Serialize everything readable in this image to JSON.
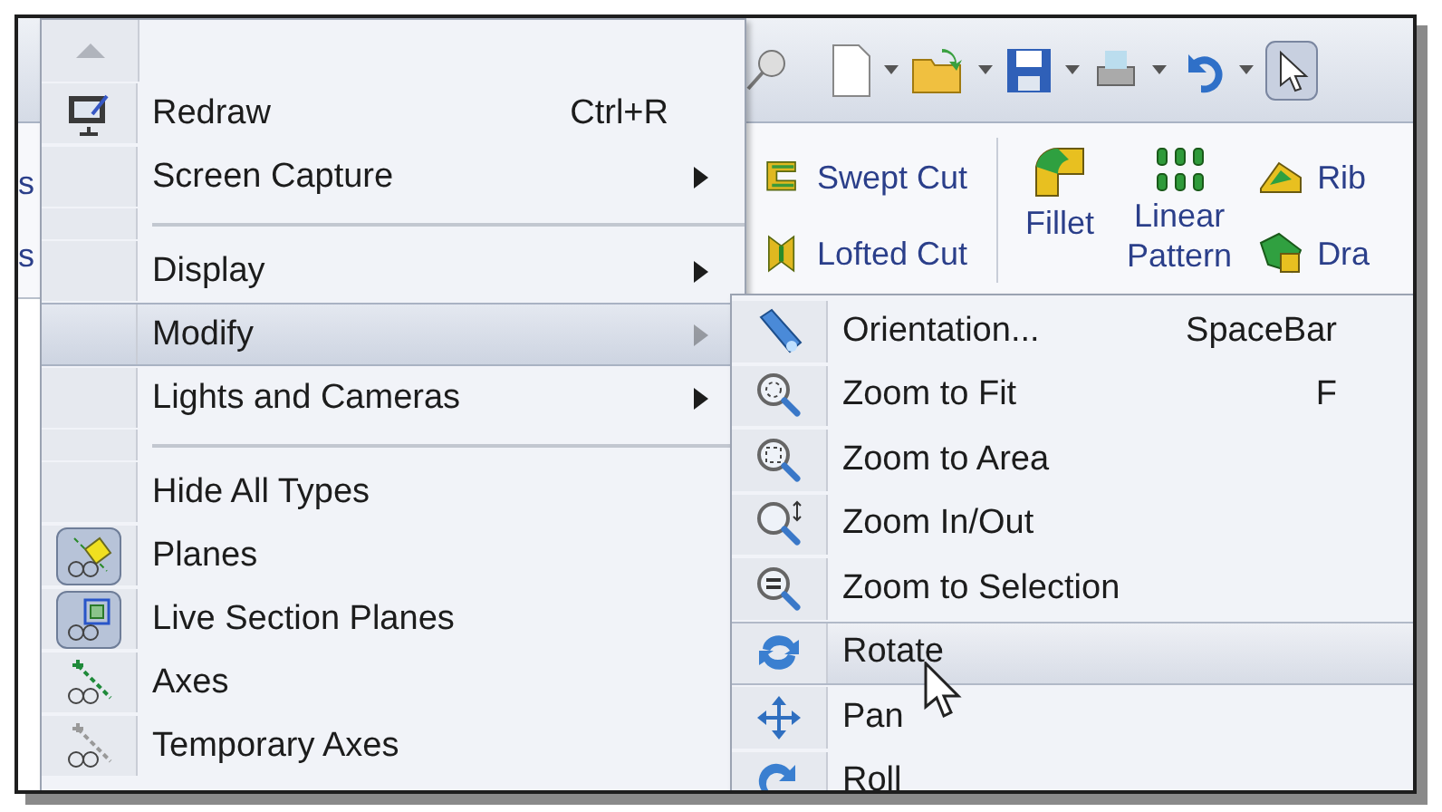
{
  "left_edge_fragments": [
    "s",
    "s"
  ],
  "ribbon": {
    "items": [
      {
        "label": "Swept Cut"
      },
      {
        "label": "Lofted Cut"
      },
      {
        "label": "Fillet"
      },
      {
        "label": "Linear Pattern"
      },
      {
        "label": "Rib"
      },
      {
        "label": "Dra"
      }
    ]
  },
  "main_menu": {
    "items": [
      {
        "kind": "item",
        "label": "Redraw",
        "shortcut": "Ctrl+R",
        "submenu": false,
        "selected": false,
        "checked": false
      },
      {
        "kind": "item",
        "label": "Screen Capture",
        "submenu": true,
        "selected": false,
        "checked": false
      },
      {
        "kind": "separator"
      },
      {
        "kind": "item",
        "label": "Display",
        "submenu": true,
        "selected": false,
        "checked": false
      },
      {
        "kind": "item",
        "label": "Modify",
        "submenu": true,
        "selected": true,
        "checked": false
      },
      {
        "kind": "item",
        "label": "Lights and Cameras",
        "submenu": true,
        "selected": false,
        "checked": false
      },
      {
        "kind": "separator"
      },
      {
        "kind": "item",
        "label": "Hide All Types",
        "submenu": false,
        "selected": false,
        "checked": false
      },
      {
        "kind": "item",
        "label": "Planes",
        "submenu": false,
        "selected": false,
        "checked": true
      },
      {
        "kind": "item",
        "label": "Live Section Planes",
        "submenu": false,
        "selected": false,
        "checked": true
      },
      {
        "kind": "item",
        "label": "Axes",
        "submenu": false,
        "selected": false,
        "checked": false
      },
      {
        "kind": "item",
        "label": "Temporary Axes",
        "submenu": false,
        "selected": false,
        "checked": false
      }
    ]
  },
  "submenu": {
    "items": [
      {
        "label": "Orientation...",
        "shortcut": "SpaceBar",
        "selected": false
      },
      {
        "label": "Zoom to Fit",
        "shortcut": "F",
        "selected": false
      },
      {
        "label": "Zoom to Area",
        "selected": false
      },
      {
        "label": "Zoom In/Out",
        "selected": false
      },
      {
        "label": "Zoom to Selection",
        "selected": false
      },
      {
        "label": "Rotate",
        "selected": true
      },
      {
        "label": "Pan",
        "selected": false
      },
      {
        "label": "Roll",
        "selected": false
      }
    ]
  }
}
